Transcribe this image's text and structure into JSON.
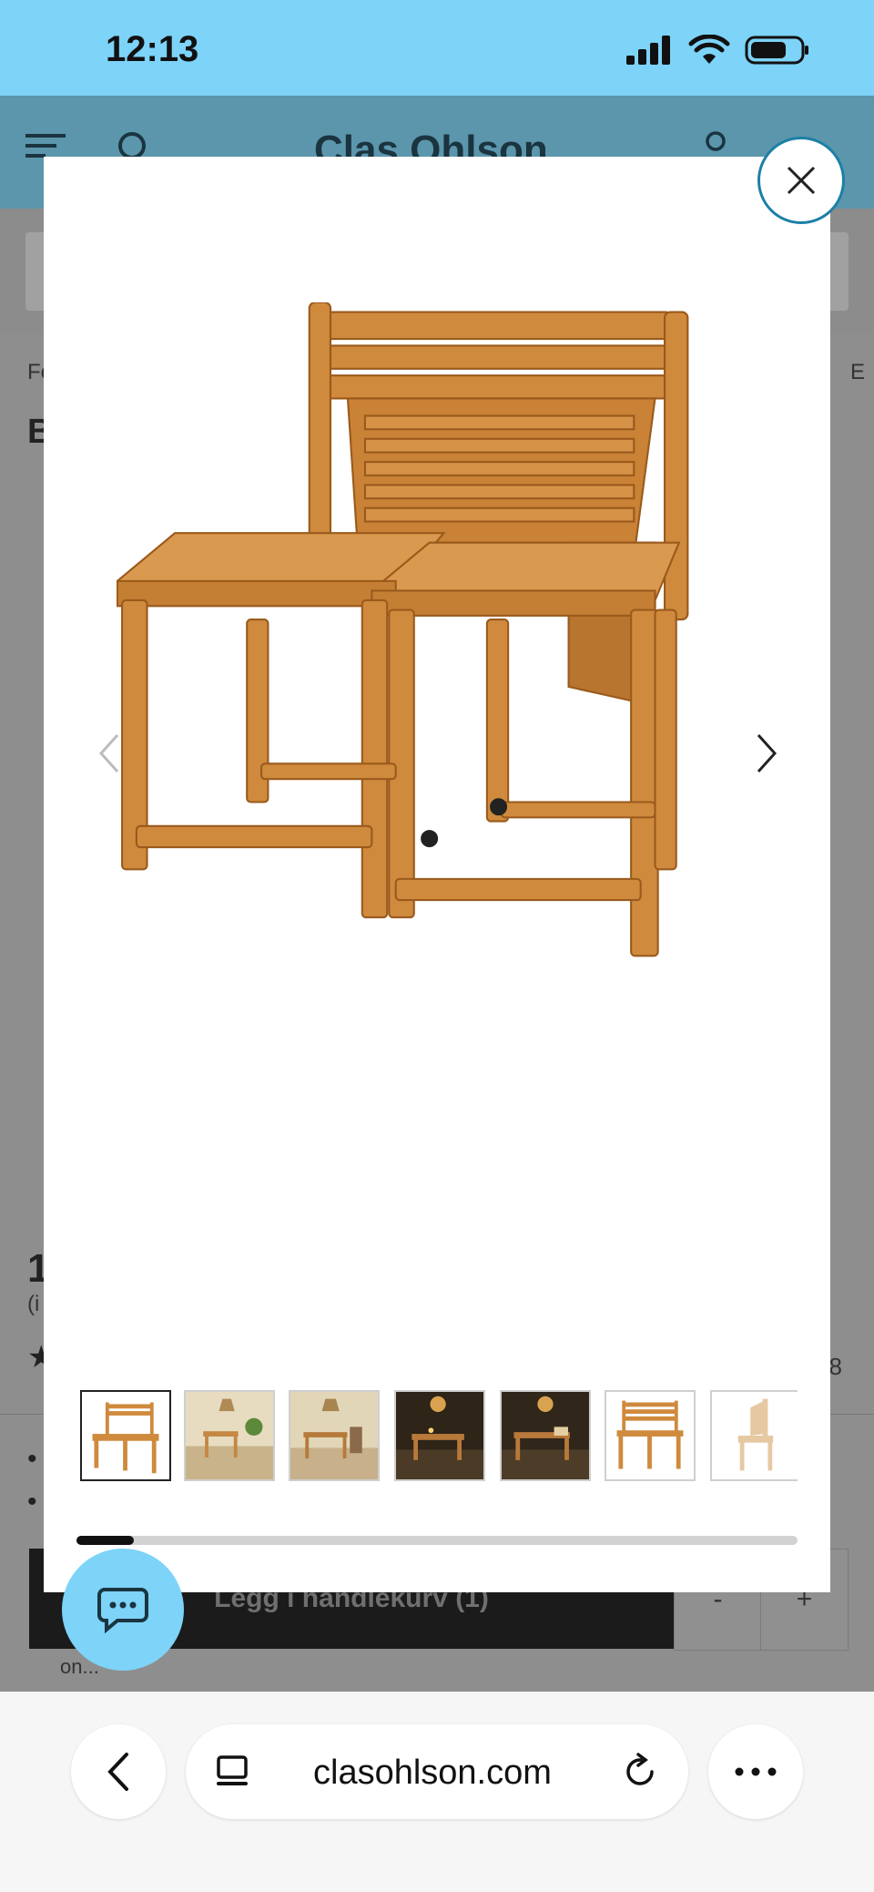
{
  "status_bar": {
    "time": "12:13"
  },
  "site": {
    "logo": "Clas Ohlson",
    "breadcrumb_left": "Fo",
    "breadcrumb_right": "E",
    "title_peek": "B",
    "price_peek": "1",
    "vat_peek": "(i",
    "review_count_peek": "8",
    "add_to_cart_label": "Legg i handlekurv (1)",
    "qty_minus": "-",
    "qty_plus": "+",
    "bottom_peek": "on..."
  },
  "gallery": {
    "thumbnail_count": 7,
    "active_index": 0,
    "progress_fraction": 0.08
  },
  "browser": {
    "url": "clasohlson.com"
  },
  "colors": {
    "accent": "#7dd3f8",
    "close_ring": "#1c7fa6",
    "wood": "#d08a3c"
  }
}
